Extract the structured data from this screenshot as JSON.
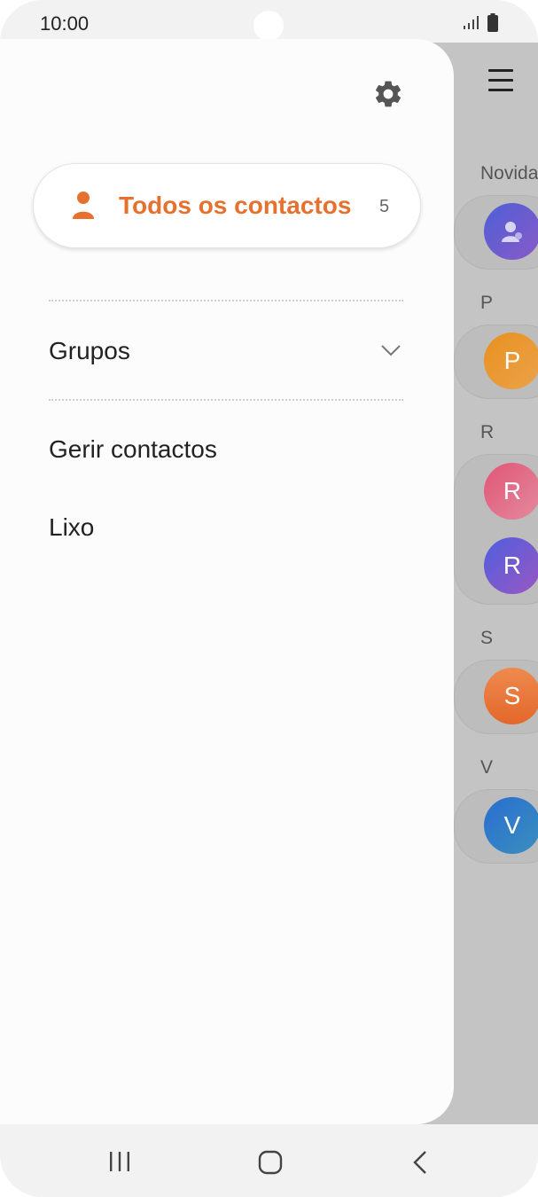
{
  "status_bar": {
    "time": "10:00"
  },
  "background_list": {
    "sections": [
      "Novida",
      "P",
      "R",
      "S",
      "V"
    ],
    "avatars": [
      {
        "letter": "",
        "color": "#6a5acd"
      },
      {
        "letter": "P",
        "color": "#e89a2b"
      },
      {
        "letter": "R",
        "color": "#e06c82"
      },
      {
        "letter": "R",
        "color": "#6b5bd6"
      },
      {
        "letter": "S",
        "color": "#e9743a"
      },
      {
        "letter": "V",
        "color": "#2f79c4"
      }
    ]
  },
  "drawer": {
    "all_contacts_label": "Todos os contactos",
    "all_contacts_count": "5",
    "groups_label": "Grupos",
    "manage_label": "Gerir contactos",
    "trash_label": "Lixo"
  },
  "colors": {
    "accent": "#e6712e"
  },
  "icons": [
    "settings-icon",
    "person-icon",
    "chevron-down-icon",
    "menu-icon",
    "signal-icon",
    "battery-icon",
    "recent-apps-icon",
    "home-icon",
    "back-icon"
  ]
}
